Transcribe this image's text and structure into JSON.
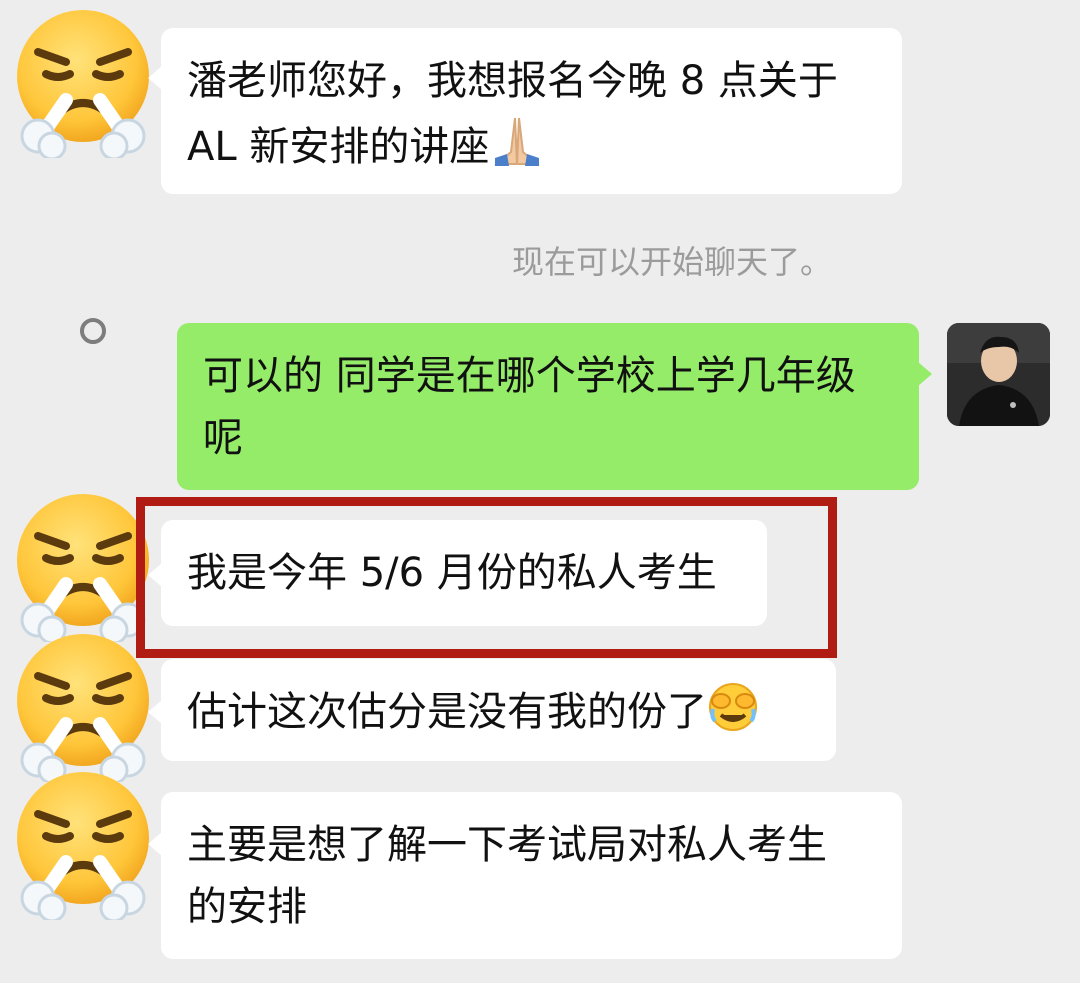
{
  "messages": [
    {
      "text": "潘老师您好，我想报名今晚 8 点关于\nAL 新安排的讲座",
      "trailing_emoji": "folded-hands-emoji"
    },
    {
      "system": "现在可以开始聊天了。"
    },
    {
      "text": "可以的 同学是在哪个学校上学几年级\n呢"
    },
    {
      "text": "我是今年 5/6 月份的私人考生"
    },
    {
      "text": "估计这次估分是没有我的份了",
      "trailing_emoji": "face-with-tears-covering-eyes-emoji"
    },
    {
      "text": "主要是想了解一下考试局对私人考生\n的安排"
    }
  ],
  "colors": {
    "background": "#ededed",
    "incoming_bubble": "#ffffff",
    "outgoing_bubble": "#95ec69",
    "highlight_border": "#b01c14",
    "system_text": "#9b9b9b"
  },
  "icons": [
    "face-with-steam-from-nose-icon",
    "sender-photo-avatar",
    "status-circle-icon"
  ]
}
